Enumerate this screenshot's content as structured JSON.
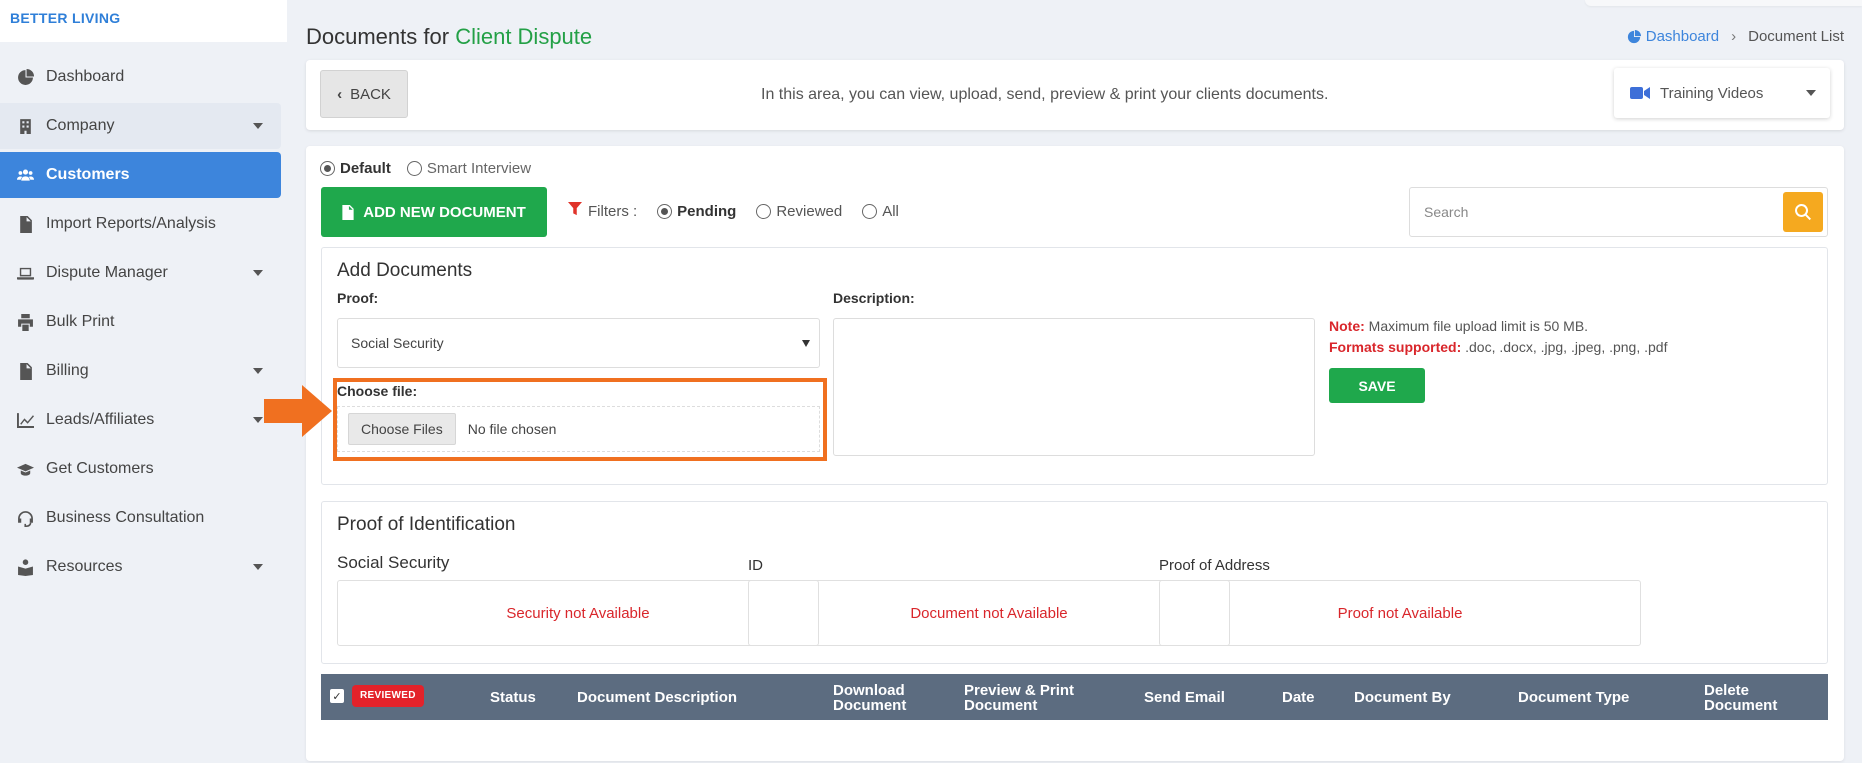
{
  "brand": "BETTER LIVING",
  "sidebar": {
    "items": [
      {
        "label": "Dashboard",
        "icon": "dashboard-icon",
        "has_caret": false,
        "active": false
      },
      {
        "label": "Company",
        "icon": "building-icon",
        "has_caret": true,
        "active": false
      },
      {
        "label": "Customers",
        "icon": "users-icon",
        "has_caret": false,
        "active": true
      },
      {
        "label": "Import Reports/Analysis",
        "icon": "import-file-icon",
        "has_caret": false,
        "active": false
      },
      {
        "label": "Dispute Manager",
        "icon": "laptop-icon",
        "has_caret": true,
        "active": false
      },
      {
        "label": "Bulk Print",
        "icon": "printer-icon",
        "has_caret": false,
        "active": false
      },
      {
        "label": "Billing",
        "icon": "invoice-icon",
        "has_caret": true,
        "active": false
      },
      {
        "label": "Leads/Affiliates",
        "icon": "chart-line-icon",
        "has_caret": true,
        "active": false
      },
      {
        "label": "Get Customers",
        "icon": "graduation-cap-icon",
        "has_caret": false,
        "active": false
      },
      {
        "label": "Business Consultation",
        "icon": "headset-icon",
        "has_caret": false,
        "active": false
      },
      {
        "label": "Resources",
        "icon": "book-reader-icon",
        "has_caret": true,
        "active": false
      }
    ]
  },
  "header": {
    "title_prefix": "Documents for",
    "title_accent": "Client Dispute",
    "breadcrumb": {
      "home": "Dashboard",
      "current": "Document List"
    }
  },
  "topbar": {
    "back_label": "BACK",
    "note": "In this area, you can view, upload, send, preview & print your clients documents.",
    "videos_label": "Training Videos"
  },
  "mode": {
    "options": [
      "Default",
      "Smart Interview"
    ],
    "selected": "Default"
  },
  "toolbar": {
    "add_label": "ADD NEW DOCUMENT",
    "filters_label": "Filters :",
    "filter_options": [
      "Pending",
      "Reviewed",
      "All"
    ],
    "filter_selected": "Pending",
    "search_placeholder": "Search"
  },
  "add_documents": {
    "title": "Add Documents",
    "proof_label": "Proof:",
    "proof_value": "Social Security",
    "description_label": "Description:",
    "choose_file_label": "Choose file:",
    "choose_files_button": "Choose Files",
    "no_file_text": "No file chosen",
    "note_label": "Note:",
    "note_text": "Maximum file upload limit is 50 MB.",
    "formats_label": "Formats supported:",
    "formats_text": ".doc, .docx, .jpg, .jpeg, .png, .pdf",
    "save_label": "SAVE"
  },
  "proof_of_id": {
    "title": "Proof of Identification",
    "columns": [
      {
        "label": "Social Security",
        "status": "Security not Available"
      },
      {
        "label": "ID",
        "status": "Document not Available"
      },
      {
        "label": "Proof of Address",
        "status": "Proof not Available"
      }
    ]
  },
  "table": {
    "badge": "REVIEWED",
    "headers": {
      "status": "Status",
      "description": "Document Description",
      "download_1": "Download",
      "download_2": "Document",
      "preview_1": "Preview & Print",
      "preview_2": "Document",
      "send_email": "Send Email",
      "date": "Date",
      "by": "Document By",
      "type": "Document Type",
      "delete_1": "Delete",
      "delete_2": "Document"
    }
  },
  "colors": {
    "accent_blue": "#3d85dc",
    "green": "#1fa84c",
    "red": "#d9262b",
    "orange": "#f07020",
    "search_yellow": "#f5a91f"
  }
}
